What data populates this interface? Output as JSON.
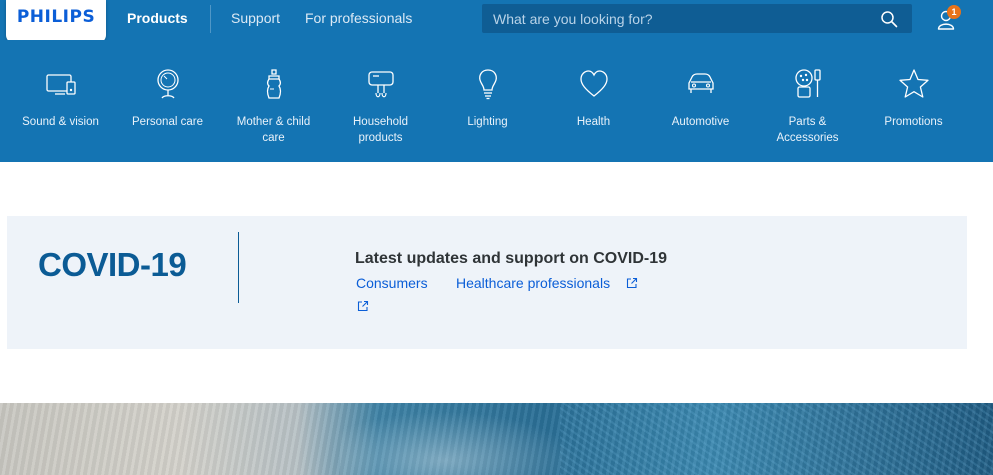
{
  "brand": {
    "logo_text": "PHILIPS"
  },
  "header": {
    "nav": {
      "products": "Products",
      "support": "Support",
      "professionals": "For professionals"
    },
    "search": {
      "placeholder": "What are you looking for?"
    },
    "account": {
      "badge_count": "1"
    }
  },
  "categories": [
    {
      "label": "Sound & vision",
      "icon": "monitor-device-icon"
    },
    {
      "label": "Personal care",
      "icon": "mirror-icon"
    },
    {
      "label": "Mother & child care",
      "icon": "baby-bottle-icon"
    },
    {
      "label": "Household products",
      "icon": "mixer-icon"
    },
    {
      "label": "Lighting",
      "icon": "light-bulb-icon"
    },
    {
      "label": "Health",
      "icon": "heart-icon"
    },
    {
      "label": "Automotive",
      "icon": "car-icon"
    },
    {
      "label": "Parts & Accessories",
      "icon": "parts-icon"
    },
    {
      "label": "Promotions",
      "icon": "star-icon"
    }
  ],
  "covid": {
    "title": "COVID-19",
    "heading": "Latest updates and support on COVID-19",
    "links": {
      "consumers": "Consumers",
      "healthcare": "Healthcare professionals"
    }
  },
  "colors": {
    "header_blue": "#1474b3",
    "search_bg": "#0f5d94",
    "accent_orange": "#e8731a",
    "covid_title": "#0b5b95",
    "link_blue": "#0b5ed7"
  }
}
